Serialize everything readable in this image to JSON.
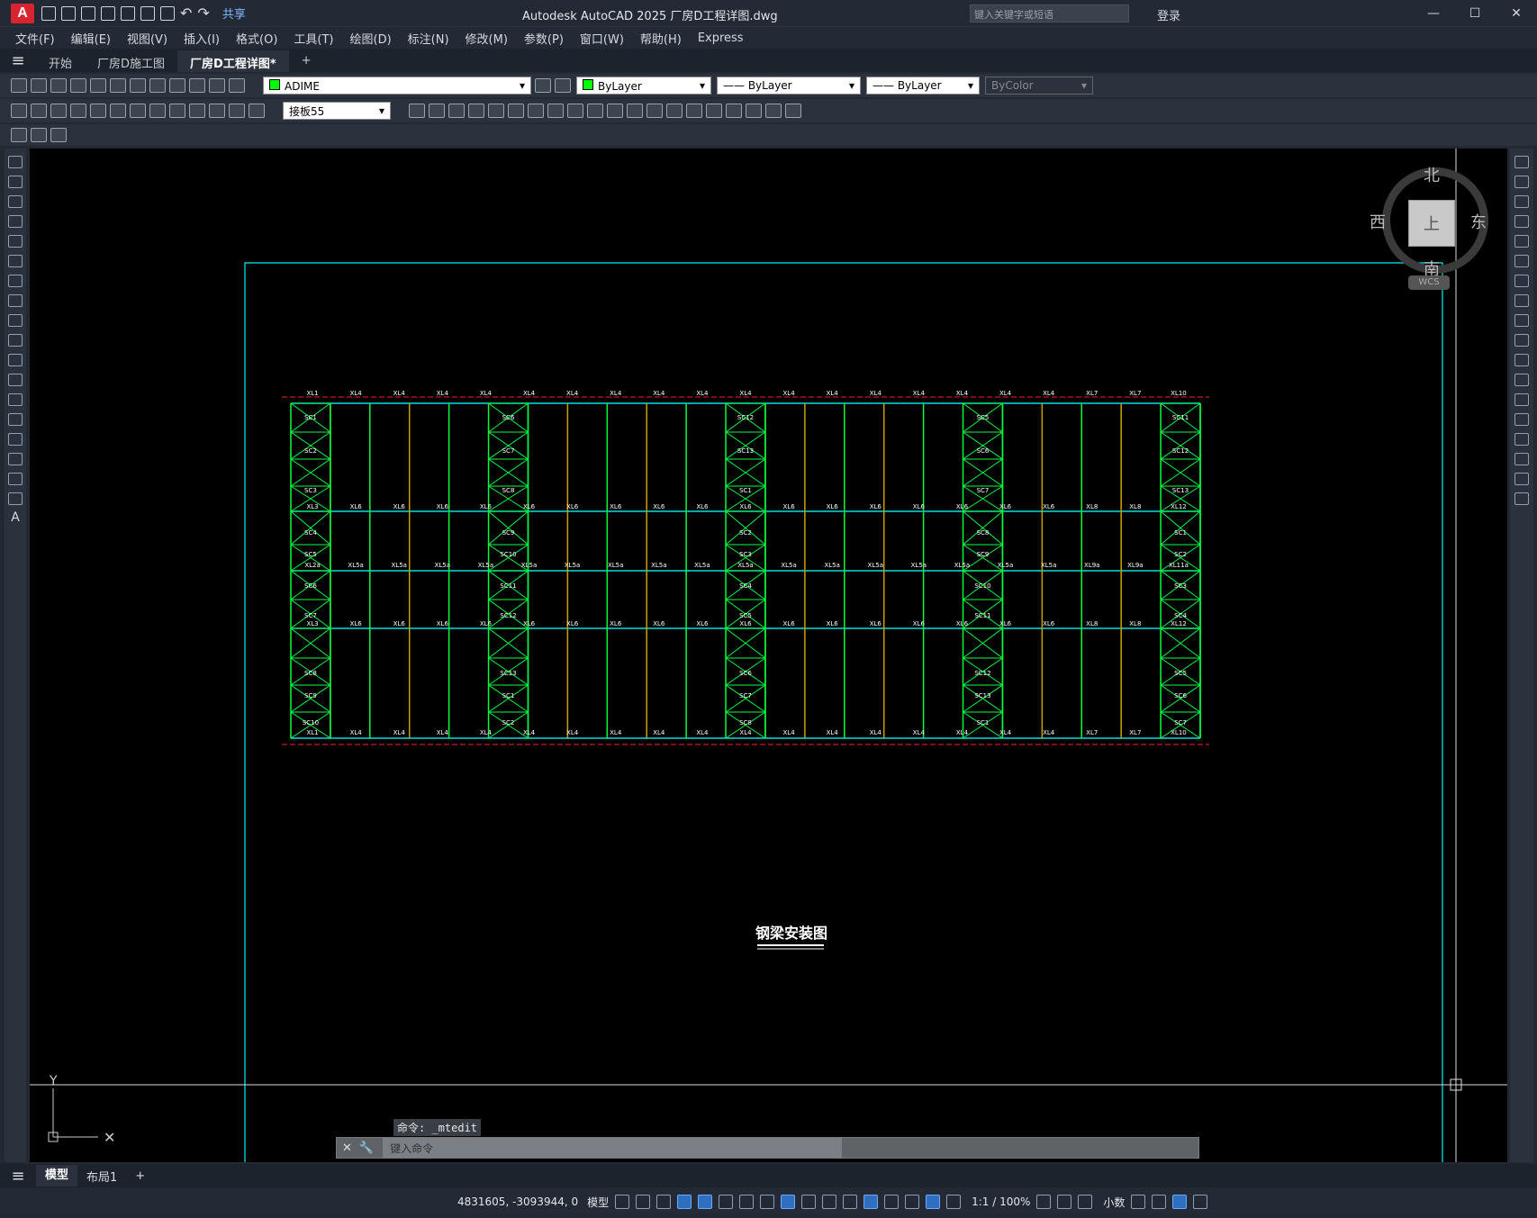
{
  "app": {
    "logo": "A",
    "share": "共享",
    "title": "Autodesk AutoCAD 2025    厂房D工程详图.dwg",
    "search_placeholder": "键入关键字或短语",
    "login": "登录"
  },
  "menu": [
    "文件(F)",
    "编辑(E)",
    "视图(V)",
    "插入(I)",
    "格式(O)",
    "工具(T)",
    "绘图(D)",
    "标注(N)",
    "修改(M)",
    "参数(P)",
    "窗口(W)",
    "帮助(H)",
    "Express"
  ],
  "doc_tabs": [
    "开始",
    "厂房D施工图",
    "厂房D工程详图*"
  ],
  "toolbar": {
    "layer": "ADIME",
    "color": "ByLayer",
    "linetype": "ByLayer",
    "lineweight": "ByLayer",
    "plotstyle": "ByColor",
    "dimstyle": "接板55"
  },
  "viewcube": {
    "north": "北",
    "south": "南",
    "east": "东",
    "west": "西",
    "face": "上",
    "wcs": "WCS"
  },
  "drawing": {
    "title": "钢梁安装图",
    "top_labels": [
      "XL1",
      "XL4",
      "XL4",
      "XL4",
      "XL4",
      "XL4",
      "XL4",
      "XL4",
      "XL4",
      "XL4",
      "XL4",
      "XL4",
      "XL4",
      "XL4",
      "XL4",
      "XL4",
      "XL4",
      "XL4",
      "XL7",
      "XL7",
      "XL10"
    ],
    "bottom_labels": [
      "XL1",
      "XL4",
      "XL4",
      "XL4",
      "XL4",
      "XL4",
      "XL4",
      "XL4",
      "XL4",
      "XL4",
      "XL4",
      "XL4",
      "XL4",
      "XL4",
      "XL4",
      "XL4",
      "XL4",
      "XL4",
      "XL7",
      "XL7",
      "XL10"
    ],
    "row2_labels": [
      "XL3",
      "XL6",
      "XL6",
      "XL6",
      "XL6",
      "XL6",
      "XL6",
      "XL6",
      "XL6",
      "XL6",
      "XL6",
      "XL6",
      "XL6",
      "XL6",
      "XL6",
      "XL6",
      "XL6",
      "XL6",
      "XL8",
      "XL8",
      "XL12"
    ],
    "row3_labels": [
      "XL2a",
      "XL5a",
      "XL5a",
      "XL5a",
      "XL5a",
      "XL5a",
      "XL5a",
      "XL5a",
      "XL5a",
      "XL5a",
      "XL5a",
      "XL5a",
      "XL5a",
      "XL5a",
      "XL5a",
      "XL5a",
      "XL5a",
      "XL5a",
      "XL9a",
      "XL9a",
      "XL11a"
    ],
    "brace_labels": [
      "SC1",
      "SC2",
      "SC3",
      "SC4",
      "SC5",
      "SC6",
      "SC7",
      "SC8",
      "SC9",
      "SC10",
      "SC11",
      "SC12",
      "SC13"
    ]
  },
  "cmd": {
    "history": "命令: _mtedit",
    "placeholder": "键入命令"
  },
  "layout_tabs": [
    "模型",
    "布局1"
  ],
  "status": {
    "coords": "4831605, -3093944, 0",
    "model": "模型",
    "scale": "1:1 / 100%",
    "units": "小数"
  }
}
